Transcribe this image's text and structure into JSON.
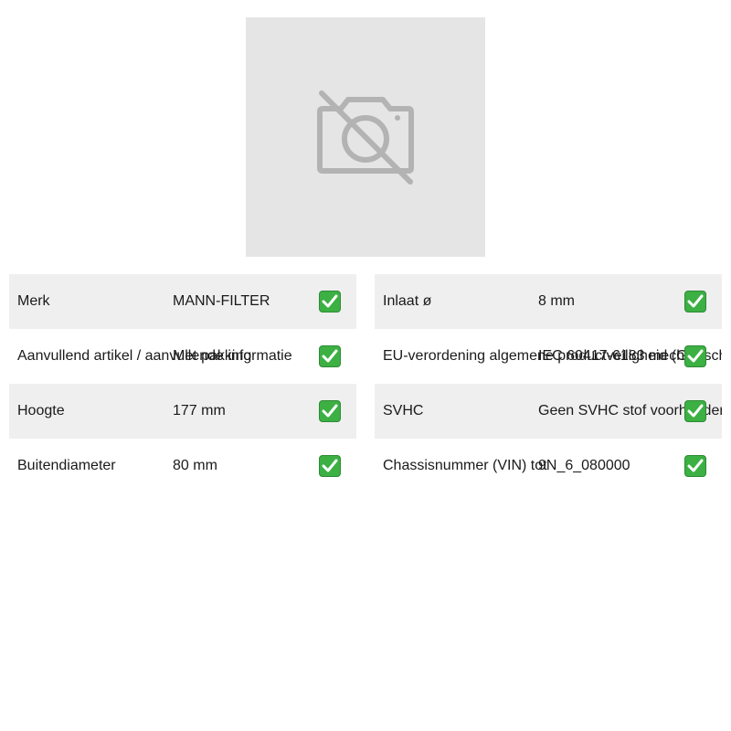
{
  "product_image": {
    "icon": "no-photo-icon"
  },
  "specs": {
    "left": [
      {
        "label": "Merk",
        "value": "MANN-FILTER",
        "check": "check-icon"
      },
      {
        "label": "Aanvullend artikel / aanvullende informatie",
        "value": "Met pakking",
        "check": "check-icon"
      },
      {
        "label": "Hoogte",
        "value": "177 mm",
        "check": "check-icon"
      },
      {
        "label": "Buitendiameter",
        "value": "80 mm",
        "check": "check-icon"
      }
    ],
    "right": [
      {
        "label": "Inlaat ø",
        "value": "8 mm",
        "check": "check-icon"
      },
      {
        "label": "EU-verordening algemene productveiligheid (GPS",
        "value": "IEC 60417-6183 mechanisch",
        "check": "check-icon"
      },
      {
        "label": "SVHC",
        "value": "Geen SVHC stof voorhanden",
        "check": "check-icon"
      },
      {
        "label": "Chassisnummer (VIN) tot",
        "value": "9N_6_080000",
        "check": "check-icon"
      }
    ]
  },
  "colors": {
    "row_shade": "#efefef",
    "placeholder_bg": "#e5e5e5",
    "check_green": "#3cb043"
  }
}
